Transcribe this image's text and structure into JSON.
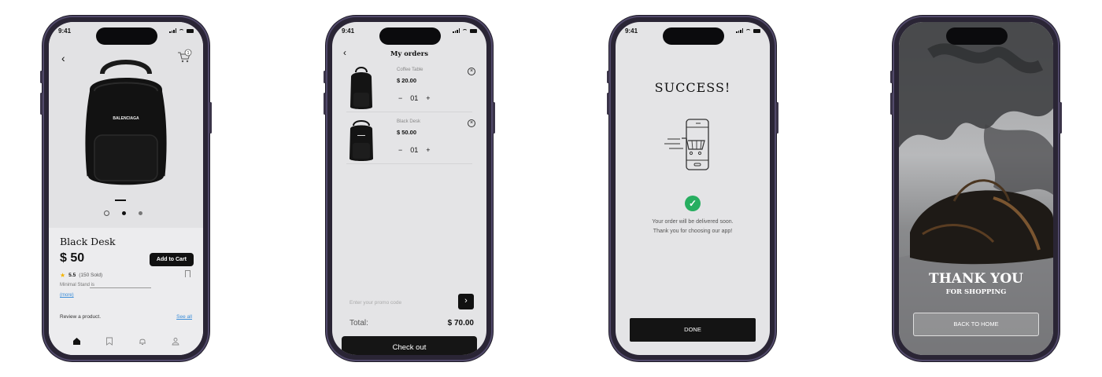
{
  "status": {
    "time": "9:41"
  },
  "product_screen": {
    "brand_on_bag": "BALENCIAGA",
    "title": "Black Desk",
    "price": "$ 50",
    "add_to_cart": "Add to Cart",
    "rating": "5.5",
    "sold": "(150 Sold)",
    "description": "Minimal Stand is",
    "more": "(more)",
    "review": "Review a product.",
    "see_all": "See all",
    "cart_badge": "1",
    "tabs": [
      "home-icon",
      "bookmark-icon",
      "bell-icon",
      "user-icon"
    ]
  },
  "orders_screen": {
    "title": "My orders",
    "items": [
      {
        "name": "Coffee Table",
        "price": "$ 20.00",
        "qty": "01"
      },
      {
        "name": "Black Desk",
        "price": "$ 50.00",
        "qty": "01"
      }
    ],
    "minus": "−",
    "plus": "+",
    "promo_placeholder": "Enter your promo code",
    "total_label": "Total:",
    "total_value": "$ 70.00",
    "checkout": "Check out"
  },
  "success_screen": {
    "title": "SUCCESS!",
    "line1": "Your order will be delivered soon.",
    "line2": "Thank you for choosing our app!",
    "done": "DONE"
  },
  "thanks_screen": {
    "title": "THANK YOU",
    "subtitle": "FOR SHOPPING",
    "back_home": "BACK TO HOME"
  }
}
